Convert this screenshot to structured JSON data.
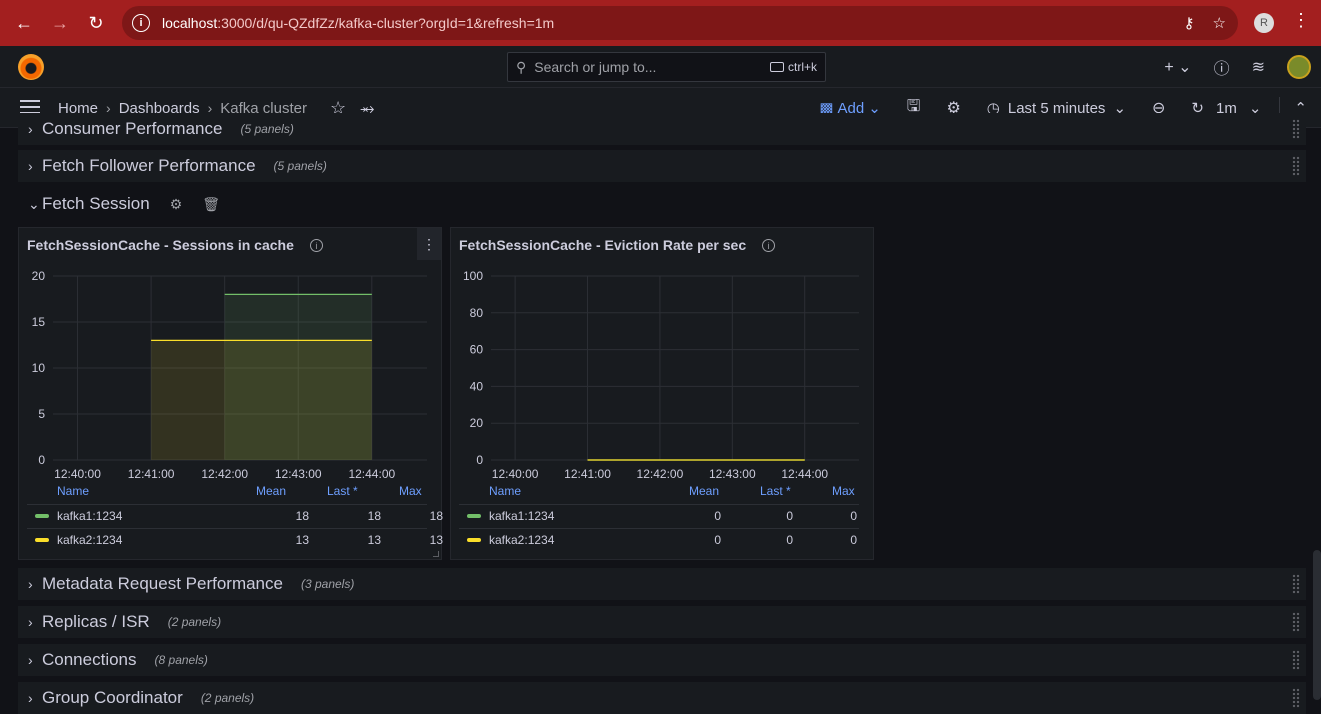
{
  "browser": {
    "url_host": "localhost",
    "url_path": ":3000/d/qu-QZdfZz/kafka-cluster?orgId=1&refresh=1m",
    "profile_initial": "R"
  },
  "topbar": {
    "search_placeholder": "Search or jump to...",
    "search_shortcut": "ctrl+k"
  },
  "breadcrumb": {
    "home": "Home",
    "dashboards": "Dashboards",
    "current": "Kafka cluster"
  },
  "toolbar": {
    "add_label": "Add",
    "time_range": "Last 5 minutes",
    "refresh_interval": "1m"
  },
  "rows": {
    "consumer": {
      "title": "Consumer Performance",
      "count": "(5 panels)"
    },
    "fetch_follower": {
      "title": "Fetch Follower Performance",
      "count": "(5 panels)"
    },
    "fetch_session": {
      "title": "Fetch Session"
    },
    "metadata": {
      "title": "Metadata Request Performance",
      "count": "(3 panels)"
    },
    "replicas": {
      "title": "Replicas / ISR",
      "count": "(2 panels)"
    },
    "connections": {
      "title": "Connections",
      "count": "(8 panels)"
    },
    "group": {
      "title": "Group Coordinator",
      "count": "(2 panels)"
    }
  },
  "panels": [
    {
      "title": "FetchSessionCache - Sessions in cache",
      "legend_headers": {
        "name": "Name",
        "mean": "Mean",
        "last": "Last *",
        "max": "Max"
      },
      "legend": [
        {
          "name": "kafka1:1234",
          "mean": "18",
          "last": "18",
          "max": "18",
          "color": "#73bf69"
        },
        {
          "name": "kafka2:1234",
          "mean": "13",
          "last": "13",
          "max": "13",
          "color": "#fade2a"
        }
      ]
    },
    {
      "title": "FetchSessionCache - Eviction Rate per sec",
      "legend_headers": {
        "name": "Name",
        "mean": "Mean",
        "last": "Last *",
        "max": "Max"
      },
      "legend": [
        {
          "name": "kafka1:1234",
          "mean": "0",
          "last": "0",
          "max": "0",
          "color": "#73bf69"
        },
        {
          "name": "kafka2:1234",
          "mean": "0",
          "last": "0",
          "max": "0",
          "color": "#fade2a"
        }
      ]
    }
  ],
  "chart_data": [
    {
      "type": "line",
      "title": "FetchSessionCache - Sessions in cache",
      "x_ticks": [
        "12:40:00",
        "12:41:00",
        "12:42:00",
        "12:43:00",
        "12:44:00"
      ],
      "y_ticks": [
        "0",
        "5",
        "10",
        "15",
        "20"
      ],
      "ylim": [
        0,
        20
      ],
      "xlim": [
        "12:39:40",
        "12:44:45"
      ],
      "series": [
        {
          "name": "kafka1:1234",
          "color": "#73bf69",
          "x": [
            "12:42:00",
            "12:44:00"
          ],
          "values": [
            18,
            18
          ]
        },
        {
          "name": "kafka2:1234",
          "color": "#fade2a",
          "x": [
            "12:41:00",
            "12:44:00"
          ],
          "values": [
            13,
            13
          ]
        }
      ]
    },
    {
      "type": "line",
      "title": "FetchSessionCache - Eviction Rate per sec",
      "x_ticks": [
        "12:40:00",
        "12:41:00",
        "12:42:00",
        "12:43:00",
        "12:44:00"
      ],
      "y_ticks": [
        "0",
        "20",
        "40",
        "60",
        "80",
        "100"
      ],
      "ylim": [
        0,
        100
      ],
      "xlim": [
        "12:39:40",
        "12:44:45"
      ],
      "series": [
        {
          "name": "kafka1:1234",
          "color": "#73bf69",
          "x": [
            "12:41:00",
            "12:44:00"
          ],
          "values": [
            0,
            0
          ]
        },
        {
          "name": "kafka2:1234",
          "color": "#fade2a",
          "x": [
            "12:41:00",
            "12:44:00"
          ],
          "values": [
            0,
            0
          ]
        }
      ]
    }
  ]
}
